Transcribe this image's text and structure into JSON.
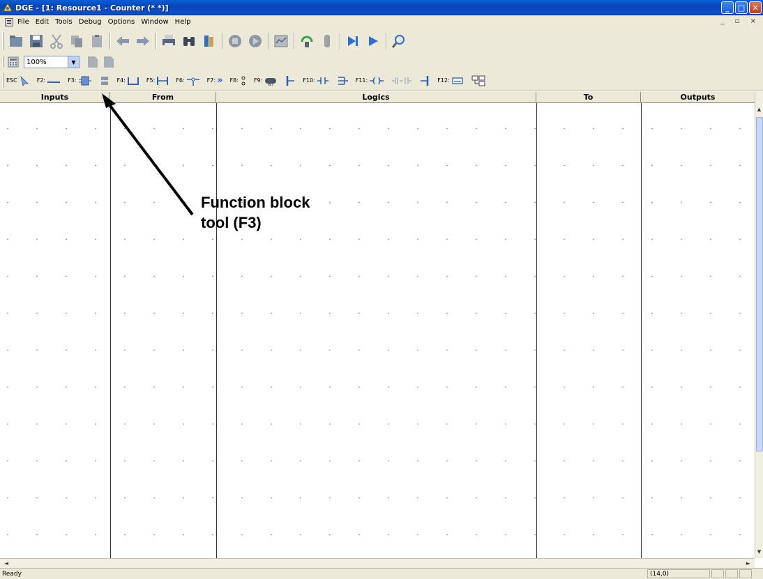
{
  "window": {
    "title": "DGE - [1: Resource1 - Counter (* *)]",
    "min_label": "_",
    "max_label": "□",
    "close_label": "✕",
    "mdi_controls": "_ ▫ ×"
  },
  "menu": {
    "items": [
      "File",
      "Edit",
      "Tools",
      "Debug",
      "Options",
      "Window",
      "Help"
    ]
  },
  "zoom": {
    "value": "100%"
  },
  "function_keys": {
    "esc": "ESC",
    "f2": "F2:",
    "f3": "F3:",
    "f4": "F4:",
    "f5": "F5:",
    "f6": "F6:",
    "f7": "F7:",
    "f8": "F8:",
    "f9": "F9:",
    "f10": "F10:",
    "f11": "F11:",
    "f12": "F12:"
  },
  "columns": {
    "inputs": "Inputs",
    "from": "From",
    "logics": "Logics",
    "to": "To",
    "outputs": "Outputs"
  },
  "annotation": {
    "line1": "Function block",
    "line2": "tool (F3)"
  },
  "status": {
    "text": "Ready",
    "coords": "(14,0)"
  }
}
